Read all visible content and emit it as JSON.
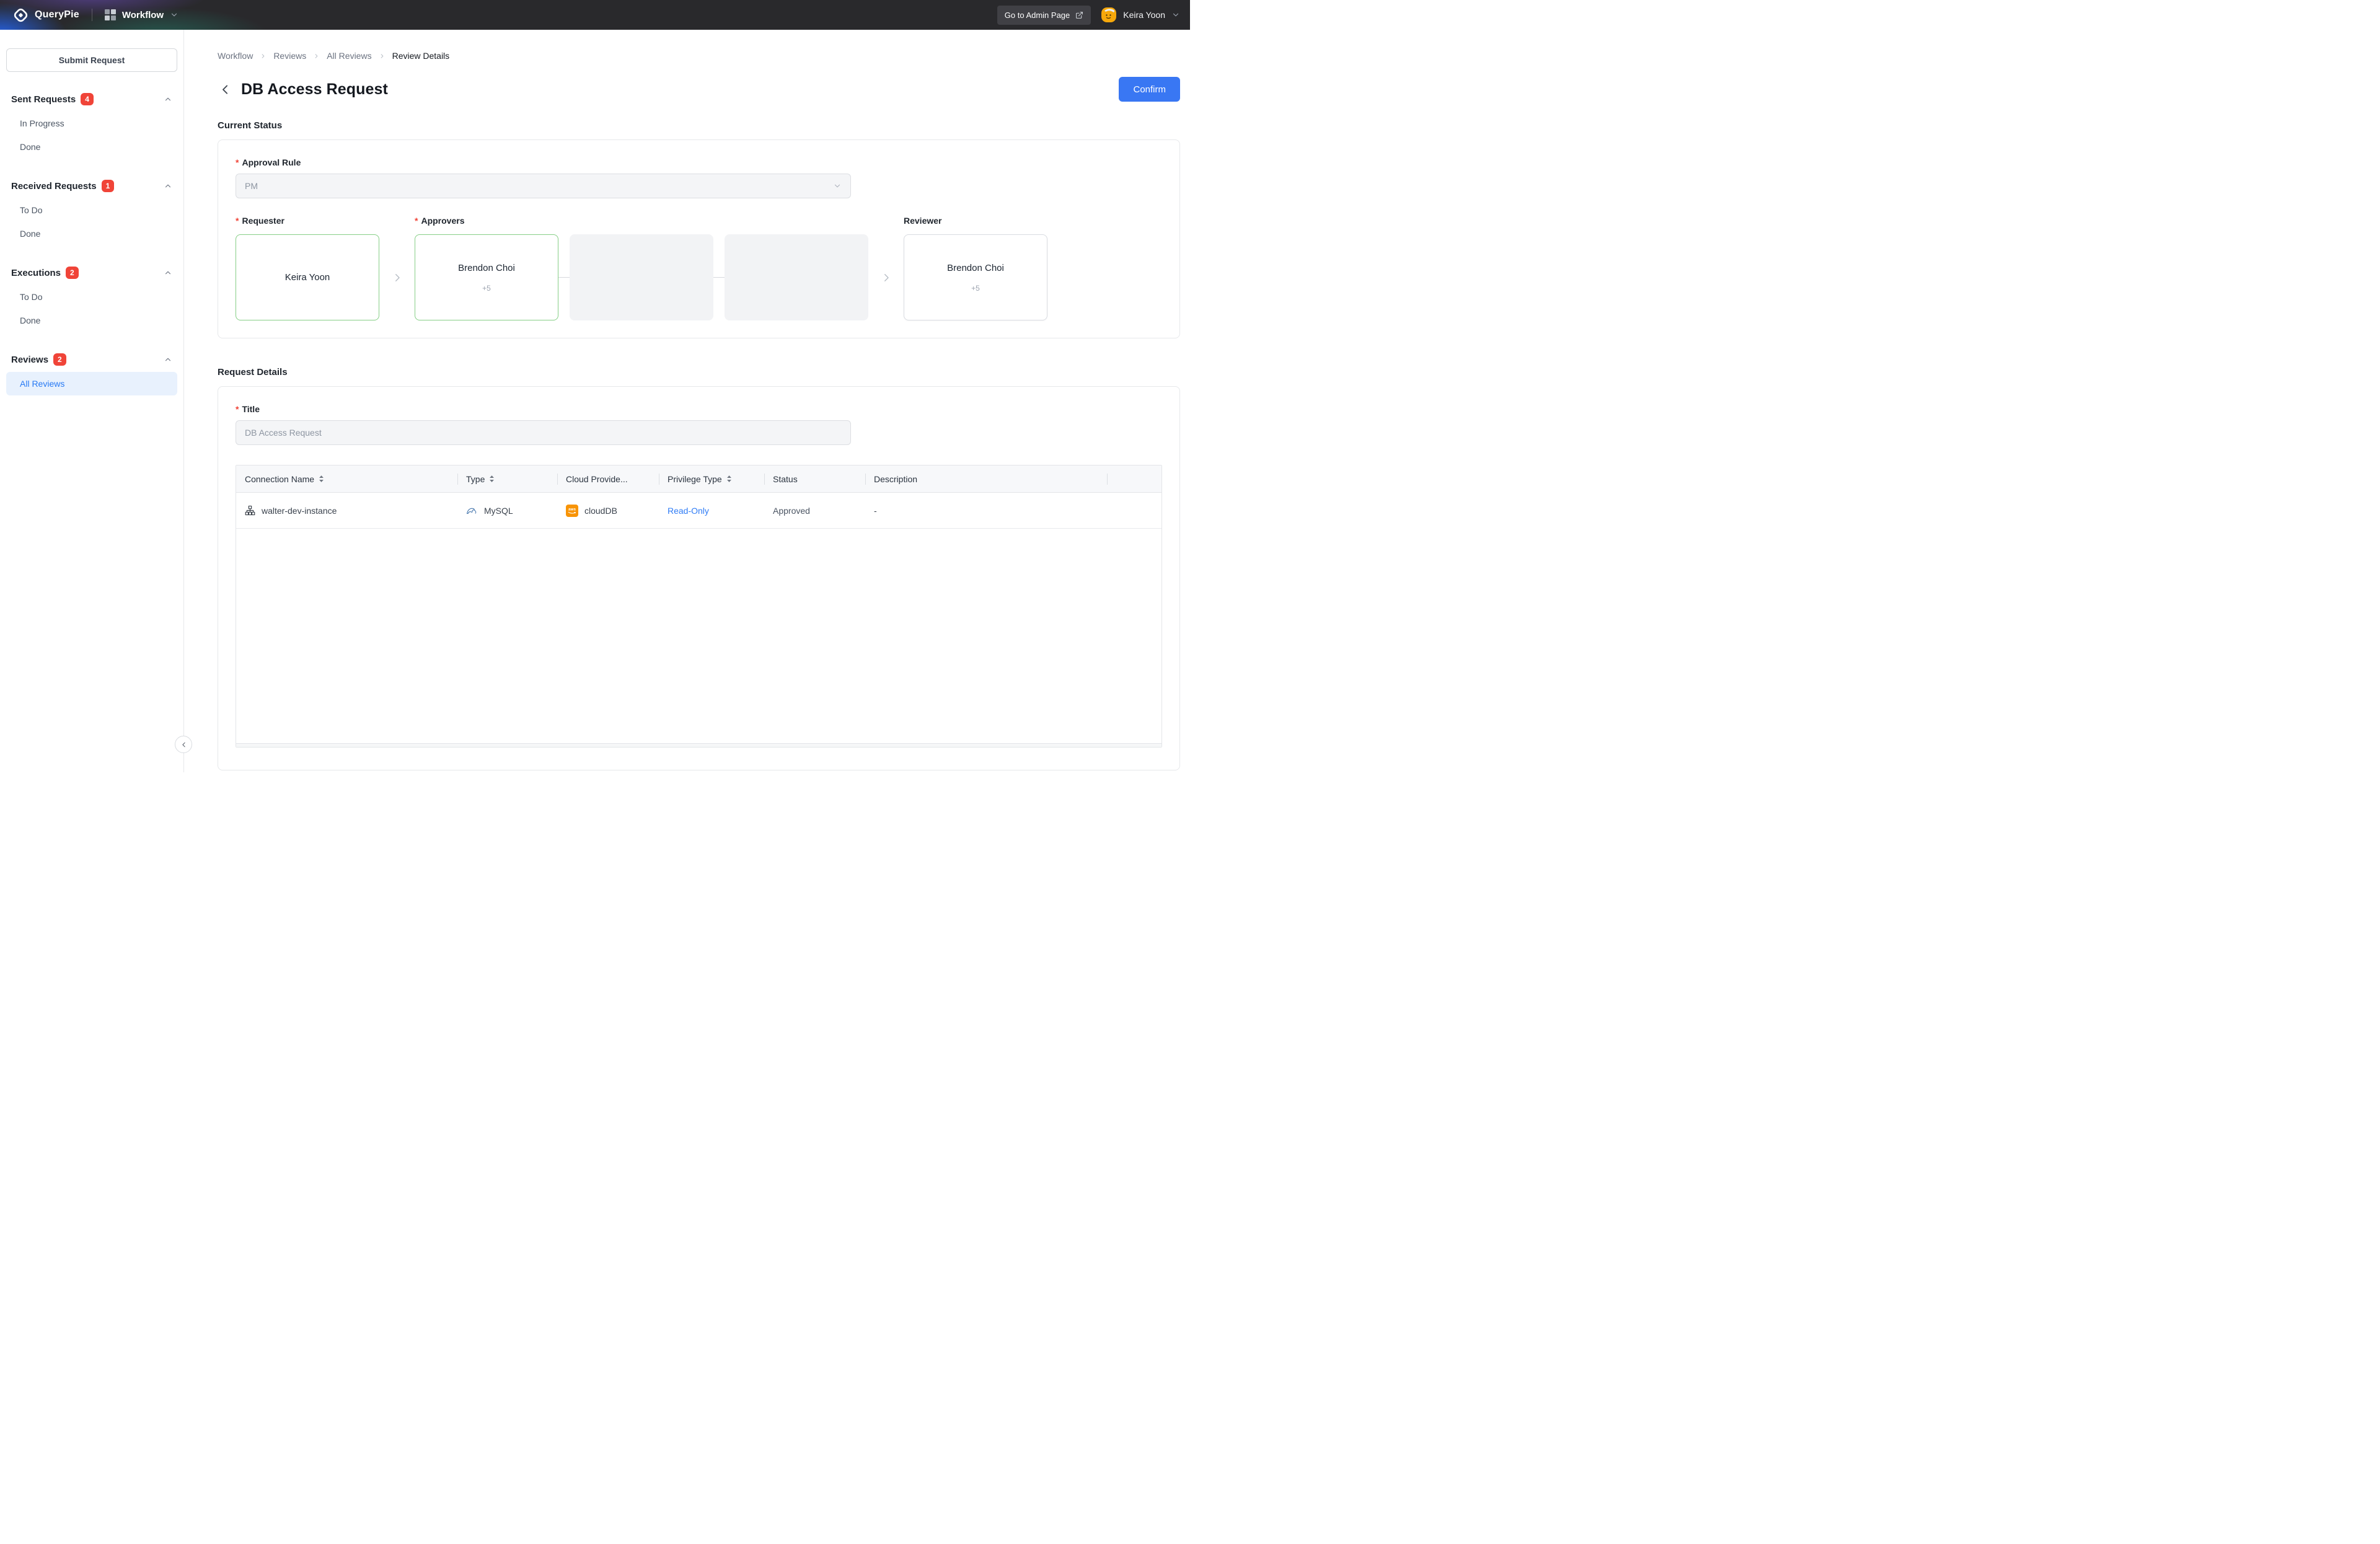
{
  "colors": {
    "topbar_bg": "#29292c",
    "accent_blue": "#3977f3",
    "badge_red": "#f04438",
    "approved_card_border_green": "#86cf86",
    "link_blue": "#2f7cf6",
    "active_item_bg": "#e8f1fd",
    "aws_orange": "#f89406"
  },
  "topbar": {
    "brand": "QueryPie",
    "app_switcher": "Workflow",
    "admin_button": "Go to Admin Page",
    "user_name": "Keira Yoon"
  },
  "sidebar": {
    "submit_button": "Submit Request",
    "sections": [
      {
        "label": "Sent Requests",
        "badge": "4",
        "items": [
          {
            "label": "In Progress"
          },
          {
            "label": "Done"
          }
        ]
      },
      {
        "label": "Received Requests",
        "badge": "1",
        "items": [
          {
            "label": "To Do"
          },
          {
            "label": "Done"
          }
        ]
      },
      {
        "label": "Executions",
        "badge": "2",
        "items": [
          {
            "label": "To Do"
          },
          {
            "label": "Done"
          }
        ]
      },
      {
        "label": "Reviews",
        "badge": "2",
        "items": [
          {
            "label": "All Reviews",
            "active": true
          }
        ]
      }
    ]
  },
  "breadcrumb": {
    "items": [
      "Workflow",
      "Reviews",
      "All Reviews",
      "Review Details"
    ]
  },
  "page": {
    "title": "DB Access Request",
    "confirm_button": "Confirm"
  },
  "current_status": {
    "heading": "Current Status",
    "approval_rule_label": "Approval Rule",
    "approval_rule_value": "PM",
    "requester_label": "Requester",
    "requester_name": "Keira Yoon",
    "approvers_label": "Approvers",
    "approver_name": "Brendon Choi",
    "approver_extra": "+5",
    "reviewer_label": "Reviewer",
    "reviewer_name": "Brendon Choi",
    "reviewer_extra": "+5"
  },
  "request_details": {
    "heading": "Request Details",
    "title_label": "Title",
    "title_value": "DB Access Request",
    "table": {
      "columns": [
        {
          "label": "Connection Name",
          "sortable": true
        },
        {
          "label": "Type",
          "sortable": true
        },
        {
          "label": "Cloud Provide...",
          "sortable": false
        },
        {
          "label": "Privilege Type",
          "sortable": true
        },
        {
          "label": "Status",
          "sortable": false
        },
        {
          "label": "Description",
          "sortable": false
        }
      ],
      "row": {
        "connection_name": "walter-dev-instance",
        "type": "MySQL",
        "cloud_provider": "cloudDB",
        "aws_icon_text": "aws",
        "privilege_type": "Read-Only",
        "status": "Approved",
        "description": "-"
      }
    }
  }
}
